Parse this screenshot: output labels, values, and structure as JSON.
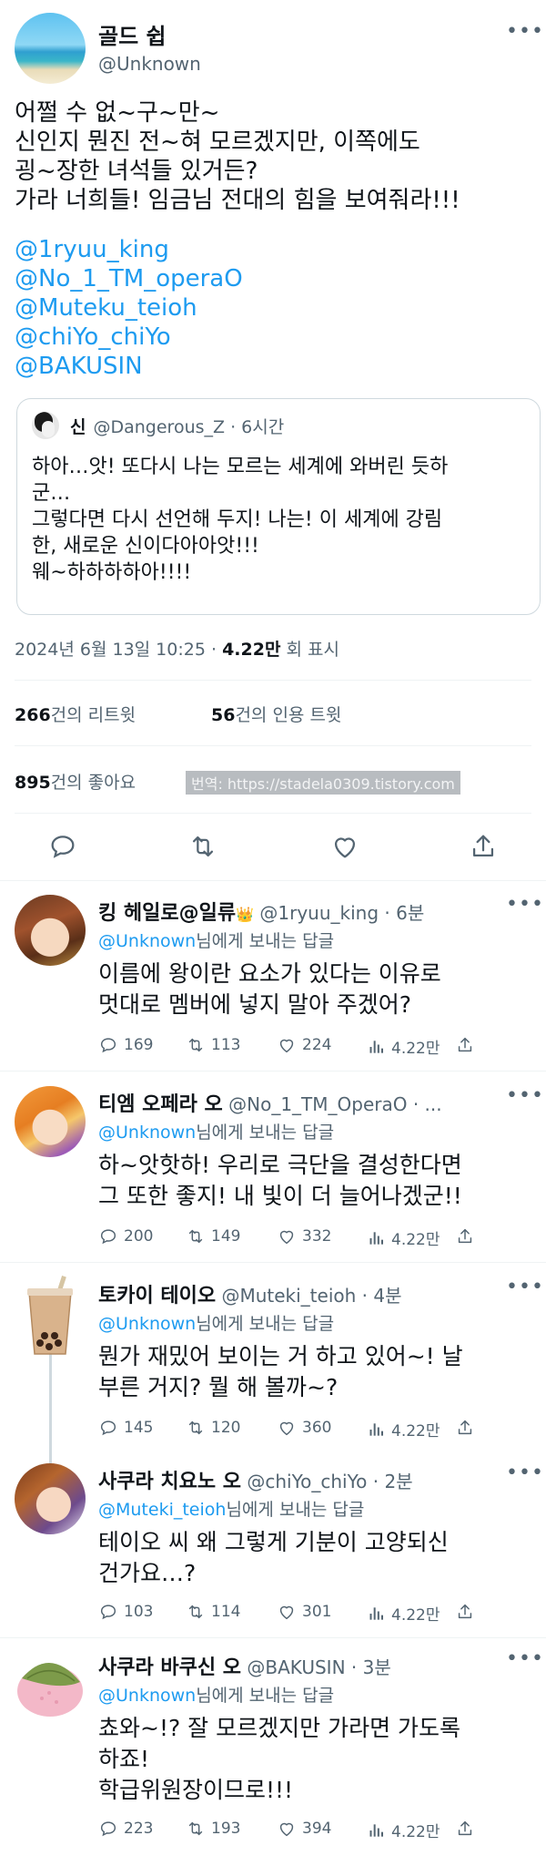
{
  "main_tweet": {
    "display_name": "골드 쉽",
    "handle": "@Unknown",
    "text_lines": [
      "어쩔 수 없~구~만~",
      "신인지 뭔진 전~혀 모르겠지만, 이쪽에도",
      "굉~장한 녀석들 있거든?",
      "가라 너희들! 임금님 전대의 힘을 보여줘라!!!"
    ],
    "mentions": [
      "@1ryuu_king",
      "@No_1_TM_operaO",
      "@Muteku_teioh",
      "@chiYo_chiYo",
      "@BAKUSIN"
    ]
  },
  "quoted_tweet": {
    "display_name": "신",
    "handle": "@Dangerous_Z",
    "time": "· 6시간",
    "text_lines": [
      "하아…앗! 또다시 나는 모르는 세계에 와버린 듯하",
      "군…",
      "그렇다면 다시 선언해 두지! 나는! 이 세계에 강림",
      "한, 새로운 신이다아아앗!!!",
      "웨~하하하하아!!!!"
    ]
  },
  "meta": {
    "date_time": "2024년 6월 13일  10:25 · ",
    "views_count": "4.22만",
    "views_label": " 회 표시",
    "retweets_count": "266",
    "retweets_label": "건의 리트윗",
    "quotes_count": "56",
    "quotes_label": "건의 인용 트윗",
    "likes_count": "895",
    "likes_label": "건의 좋아요",
    "watermark": "번역: https://stadela0309.tistory.com"
  },
  "action_icons": [
    "reply-icon",
    "retweet-icon",
    "like-icon",
    "share-icon"
  ],
  "replies": [
    {
      "name": "킹 헤일로@일류",
      "badge": "👑",
      "handle": "@1ryuu_king",
      "time": "· 6분",
      "to": "@Unknown",
      "to_suffix": "님에게 보내는 답글",
      "text_lines": [
        "이름에 왕이란 요소가 있다는 이유로",
        "멋대로 멤버에 넣지 말아 주겠어?"
      ],
      "replies": "169",
      "retweets": "113",
      "likes": "224",
      "views": "4.22만"
    },
    {
      "name": "티엠 오페라 오",
      "badge": "",
      "handle": "@No_1_TM_OperaO · ...",
      "time": "",
      "to": "@Unknown",
      "to_suffix": "님에게 보내는 답글",
      "text_lines": [
        "하~앗핫하! 우리로 극단을 결성한다면",
        "그 또한 좋지! 내 빛이 더 늘어나겠군!!"
      ],
      "replies": "200",
      "retweets": "149",
      "likes": "332",
      "views": "4.22만"
    },
    {
      "name": "토카이 테이오",
      "badge": "",
      "handle": "@Muteki_teioh",
      "time": "· 4분",
      "to": "@Unknown",
      "to_suffix": "님에게 보내는 답글",
      "text_lines": [
        "뭔가 재밌어 보이는 거 하고 있어~! 날",
        "부른 거지? 뭘 해 볼까~?"
      ],
      "replies": "145",
      "retweets": "120",
      "likes": "360",
      "views": "4.22만"
    },
    {
      "name": "사쿠라 치요노 오",
      "badge": "",
      "handle": "@chiYo_chiYo",
      "time": "· 2분",
      "to": "@Muteki_teioh",
      "to_suffix": "님에게 보내는 답글",
      "text_lines": [
        "테이오 씨 왜 그렇게 기분이 고양되신",
        "건가요…?"
      ],
      "replies": "103",
      "retweets": "114",
      "likes": "301",
      "views": "4.22만"
    },
    {
      "name": "사쿠라 바쿠신 오",
      "badge": "",
      "handle": "@BAKUSIN",
      "time": "· 3분",
      "to": "@Unknown",
      "to_suffix": "님에게 보내는 답글",
      "text_lines": [
        "쵸와~!? 잘 모르겠지만 가라면 가도록",
        "하죠!",
        "학급위원장이므로!!!"
      ],
      "replies": "223",
      "retweets": "193",
      "likes": "394",
      "views": "4.22만"
    }
  ]
}
